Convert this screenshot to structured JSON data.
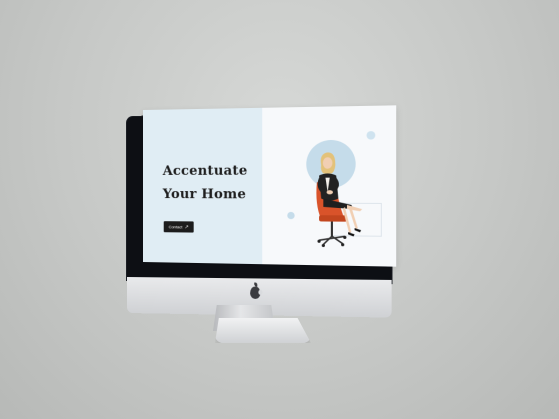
{
  "hero": {
    "headline_line1": "Accentuate",
    "headline_line2": "Your Home",
    "cta_label": "Contact",
    "cta_arrow": "↗"
  },
  "colors": {
    "background": "#c6c8c6",
    "hero_left_bg": "#e0edf4",
    "accent_circle": "#c5dcea",
    "button_bg": "#1c1c1c",
    "chair": "#d9532a"
  },
  "icons": {
    "device_logo": "apple-logo-icon",
    "cta_icon": "arrow-up-right-icon"
  }
}
